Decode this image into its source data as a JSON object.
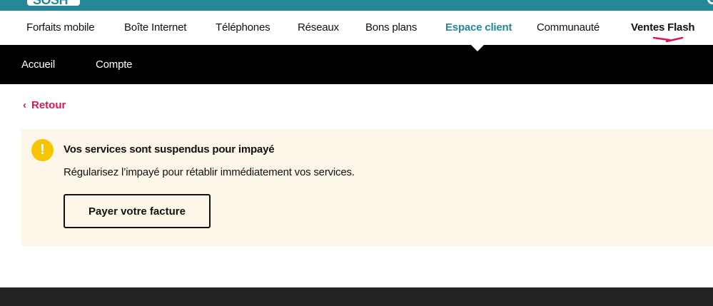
{
  "brand": {
    "logo_text": "SOSH",
    "primary_color": "#258797",
    "accent_color": "#d6185a",
    "icon": "search-icon"
  },
  "main_nav": {
    "items": [
      {
        "label": "Forfaits mobile"
      },
      {
        "label": "Boîte Internet"
      },
      {
        "label": "Téléphones"
      },
      {
        "label": "Réseaux"
      },
      {
        "label": "Bons plans"
      },
      {
        "label": "Espace client",
        "active": true
      },
      {
        "label": "Communauté"
      },
      {
        "label": "Ventes Flash"
      }
    ]
  },
  "sub_nav": {
    "items": [
      {
        "label": "Accueil"
      },
      {
        "label": "Compte"
      }
    ]
  },
  "back": {
    "label": "Retour",
    "icon": "chevron-left-icon"
  },
  "alert": {
    "icon": "exclamation-icon",
    "icon_color": "#f7c400",
    "title": "Vos services sont suspendus pour impayé",
    "text": "Régularisez l’impayé pour rétablir immédiatement vos services.",
    "button_label": "Payer votre facture"
  }
}
